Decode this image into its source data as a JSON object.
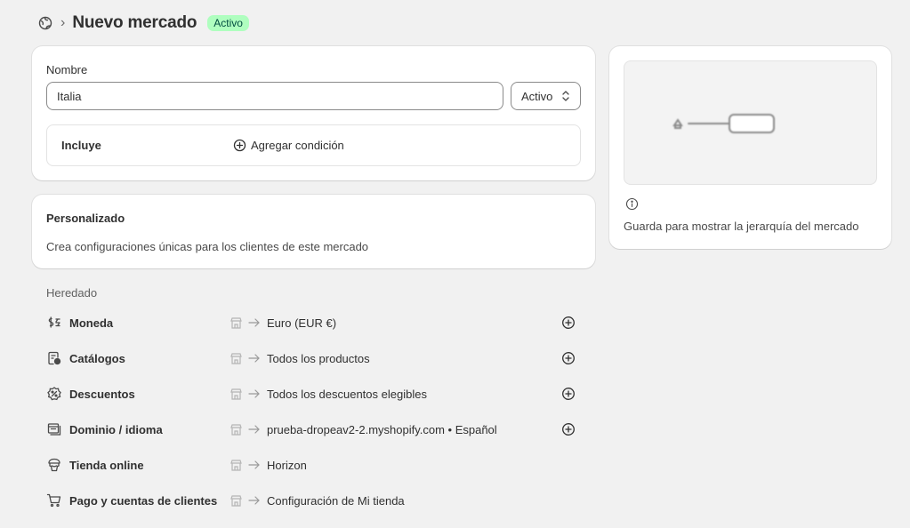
{
  "header": {
    "icon": "globe-market-icon",
    "separator": "›",
    "title": "Nuevo mercado",
    "status_badge": "Activo"
  },
  "name_card": {
    "label": "Nombre",
    "input_value": "Italia",
    "status_select": "Activo",
    "includes_label": "Incluye",
    "add_condition": "Agregar condición"
  },
  "custom_card": {
    "title": "Personalizado",
    "description": "Crea configuraciones únicas para los clientes de este mercado"
  },
  "inherited": {
    "title": "Heredado",
    "rows": [
      {
        "label": "Moneda",
        "icon": "currency-icon",
        "value": "Euro (EUR €)",
        "has_add": true
      },
      {
        "label": "Catálogos",
        "icon": "catalog-icon",
        "value": "Todos los productos",
        "has_add": true
      },
      {
        "label": "Descuentos",
        "icon": "discount-icon",
        "value": "Todos los descuentos elegibles",
        "has_add": true
      },
      {
        "label": "Dominio / idioma",
        "icon": "domain-icon",
        "value": "prueba-dropeav2-2.myshopify.com • Español",
        "has_add": true
      },
      {
        "label": "Tienda online",
        "icon": "online-store-icon",
        "value": "Horizon",
        "has_add": false
      },
      {
        "label": "Pago y cuentas de clientes",
        "icon": "cart-icon",
        "value": "Configuración de Mi tienda",
        "has_add": false
      }
    ]
  },
  "side_card": {
    "info_text": "Guarda para mostrar la jerarquía del mercado"
  },
  "colors": {
    "badge_bg": "#affebf",
    "badge_text": "#014b40",
    "page_bg": "#f1f1f1",
    "card_bg": "#ffffff"
  }
}
